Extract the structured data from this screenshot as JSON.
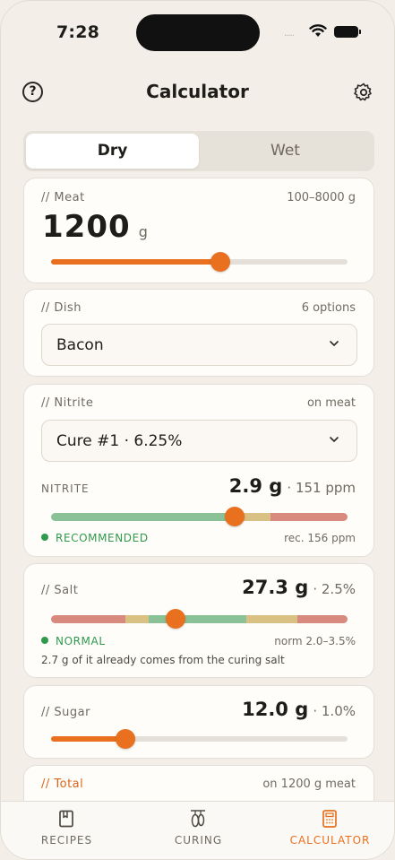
{
  "status": {
    "time": "7:28",
    "signal": "....."
  },
  "header": {
    "title": "Calculator",
    "help_glyph": "?"
  },
  "mode": {
    "tabs": [
      "Dry",
      "Wet"
    ],
    "active": "Dry"
  },
  "meat": {
    "label": "// Meat",
    "range": "100–8000 g",
    "value": "1200",
    "unit": "g",
    "slider_fraction": 0.57
  },
  "dish": {
    "label": "// Dish",
    "count": "6 options",
    "selected": "Bacon"
  },
  "nitrite": {
    "label": "// Nitrite",
    "basis": "on meat",
    "selected": "Cure #1 · 6.25%",
    "metric_label": "NITRITE",
    "grams": "2.9 g",
    "ppm": "· 151 ppm",
    "status": "RECOMMENDED",
    "rec": "rec. 156 ppm",
    "marker_fraction": 0.62
  },
  "salt": {
    "label": "// Salt",
    "grams": "27.3 g",
    "pct": "· 2.5%",
    "status": "NORMAL",
    "norm": "norm 2.0–3.5%",
    "note": "2.7 g of it already comes from the curing salt",
    "marker_fraction": 0.42
  },
  "sugar": {
    "label": "// Sugar",
    "grams": "12.0 g",
    "pct": "· 1.0%",
    "slider_fraction": 0.25
  },
  "total": {
    "label": "// Total",
    "basis": "on 1200 g meat"
  },
  "tabbar": {
    "items": [
      {
        "label": "RECIPES",
        "icon": "book-icon"
      },
      {
        "label": "CURING",
        "icon": "hanging-meat-icon"
      },
      {
        "label": "CALCULATOR",
        "icon": "calculator-icon"
      }
    ],
    "active": "CALCULATOR"
  },
  "colors": {
    "accent": "#e8701f",
    "green": "#8bc196",
    "yellow": "#d9c183",
    "red": "#d98a7e",
    "ok_text": "#2f9a4c"
  }
}
